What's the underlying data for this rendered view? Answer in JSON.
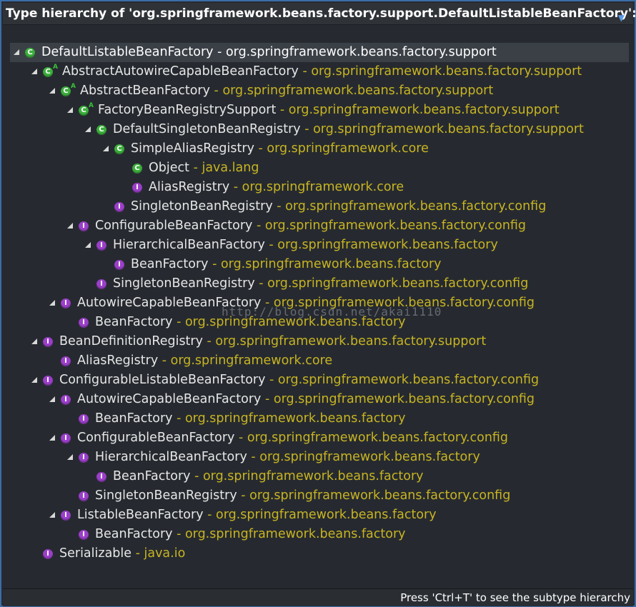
{
  "header": {
    "title": "Type hierarchy of 'org.springframework.beans.factory.support.DefaultListableBeanFactory':",
    "menu_icon": "chevron-down-icon"
  },
  "separator": " - ",
  "tree": [
    {
      "level": 0,
      "toggle": true,
      "kind": "class",
      "abstract": false,
      "name": "DefaultListableBeanFactory",
      "pkg": "org.springframework.beans.factory.support",
      "selected": true
    },
    {
      "level": 1,
      "toggle": true,
      "kind": "class",
      "abstract": true,
      "name": "AbstractAutowireCapableBeanFactory",
      "pkg": "org.springframework.beans.factory.support"
    },
    {
      "level": 2,
      "toggle": true,
      "kind": "class",
      "abstract": true,
      "name": "AbstractBeanFactory",
      "pkg": "org.springframework.beans.factory.support"
    },
    {
      "level": 3,
      "toggle": true,
      "kind": "class",
      "abstract": true,
      "name": "FactoryBeanRegistrySupport",
      "pkg": "org.springframework.beans.factory.support"
    },
    {
      "level": 4,
      "toggle": true,
      "kind": "class",
      "abstract": false,
      "name": "DefaultSingletonBeanRegistry",
      "pkg": "org.springframework.beans.factory.support"
    },
    {
      "level": 5,
      "toggle": true,
      "kind": "class",
      "abstract": false,
      "name": "SimpleAliasRegistry",
      "pkg": "org.springframework.core"
    },
    {
      "level": 6,
      "toggle": false,
      "kind": "class",
      "abstract": false,
      "name": "Object",
      "pkg": "java.lang"
    },
    {
      "level": 6,
      "toggle": false,
      "kind": "iface",
      "abstract": false,
      "name": "AliasRegistry",
      "pkg": "org.springframework.core"
    },
    {
      "level": 5,
      "toggle": false,
      "kind": "iface",
      "abstract": false,
      "name": "SingletonBeanRegistry",
      "pkg": "org.springframework.beans.factory.config"
    },
    {
      "level": 3,
      "toggle": true,
      "kind": "iface",
      "abstract": false,
      "name": "ConfigurableBeanFactory",
      "pkg": "org.springframework.beans.factory.config"
    },
    {
      "level": 4,
      "toggle": true,
      "kind": "iface",
      "abstract": false,
      "name": "HierarchicalBeanFactory",
      "pkg": "org.springframework.beans.factory"
    },
    {
      "level": 5,
      "toggle": false,
      "kind": "iface",
      "abstract": false,
      "name": "BeanFactory",
      "pkg": "org.springframework.beans.factory"
    },
    {
      "level": 4,
      "toggle": false,
      "kind": "iface",
      "abstract": false,
      "name": "SingletonBeanRegistry",
      "pkg": "org.springframework.beans.factory.config"
    },
    {
      "level": 2,
      "toggle": true,
      "kind": "iface",
      "abstract": false,
      "name": "AutowireCapableBeanFactory",
      "pkg": "org.springframework.beans.factory.config"
    },
    {
      "level": 3,
      "toggle": false,
      "kind": "iface",
      "abstract": false,
      "name": "BeanFactory",
      "pkg": "org.springframework.beans.factory"
    },
    {
      "level": 1,
      "toggle": true,
      "kind": "iface",
      "abstract": false,
      "name": "BeanDefinitionRegistry",
      "pkg": "org.springframework.beans.factory.support"
    },
    {
      "level": 2,
      "toggle": false,
      "kind": "iface",
      "abstract": false,
      "name": "AliasRegistry",
      "pkg": "org.springframework.core"
    },
    {
      "level": 1,
      "toggle": true,
      "kind": "iface",
      "abstract": false,
      "name": "ConfigurableListableBeanFactory",
      "pkg": "org.springframework.beans.factory.config"
    },
    {
      "level": 2,
      "toggle": true,
      "kind": "iface",
      "abstract": false,
      "name": "AutowireCapableBeanFactory",
      "pkg": "org.springframework.beans.factory.config"
    },
    {
      "level": 3,
      "toggle": false,
      "kind": "iface",
      "abstract": false,
      "name": "BeanFactory",
      "pkg": "org.springframework.beans.factory"
    },
    {
      "level": 2,
      "toggle": true,
      "kind": "iface",
      "abstract": false,
      "name": "ConfigurableBeanFactory",
      "pkg": "org.springframework.beans.factory.config"
    },
    {
      "level": 3,
      "toggle": true,
      "kind": "iface",
      "abstract": false,
      "name": "HierarchicalBeanFactory",
      "pkg": "org.springframework.beans.factory"
    },
    {
      "level": 4,
      "toggle": false,
      "kind": "iface",
      "abstract": false,
      "name": "BeanFactory",
      "pkg": "org.springframework.beans.factory"
    },
    {
      "level": 3,
      "toggle": false,
      "kind": "iface",
      "abstract": false,
      "name": "SingletonBeanRegistry",
      "pkg": "org.springframework.beans.factory.config"
    },
    {
      "level": 2,
      "toggle": true,
      "kind": "iface",
      "abstract": false,
      "name": "ListableBeanFactory",
      "pkg": "org.springframework.beans.factory"
    },
    {
      "level": 3,
      "toggle": false,
      "kind": "iface",
      "abstract": false,
      "name": "BeanFactory",
      "pkg": "org.springframework.beans.factory"
    },
    {
      "level": 1,
      "toggle": false,
      "kind": "iface",
      "abstract": false,
      "name": "Serializable",
      "pkg": "java.io"
    }
  ],
  "watermark": "http://blog.csdn.net/akai1110",
  "footer": {
    "hint": "Press 'Ctrl+T' to see the subtype hierarchy"
  },
  "colors": {
    "package_text": "#c8b422",
    "class_icon": "#3caf3c",
    "interface_icon": "#9b3fc9",
    "frame_border": "#3b6da8"
  }
}
